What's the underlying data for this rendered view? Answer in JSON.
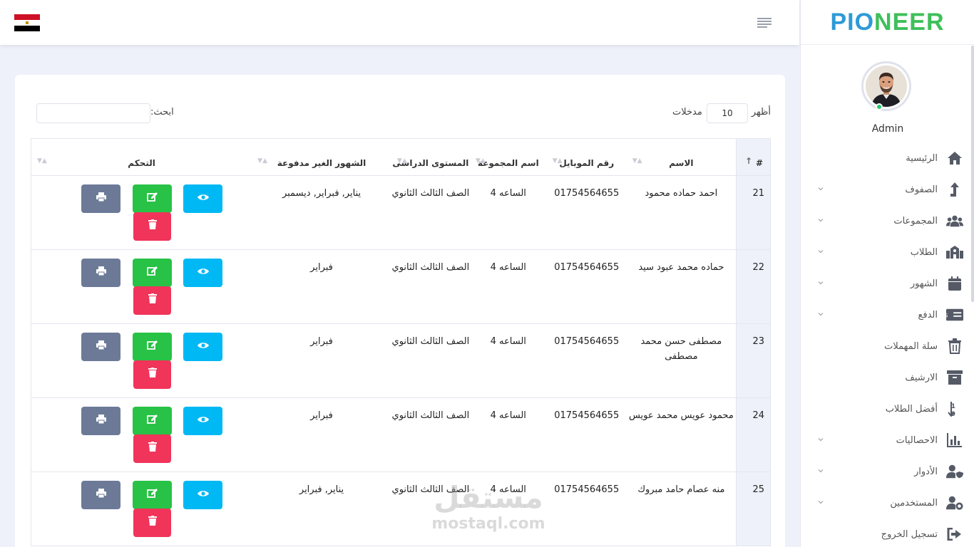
{
  "header": {
    "flag": "egypt-flag"
  },
  "sidebar": {
    "logo_part1": "PIO",
    "logo_part2": "NEER",
    "user": "Admin",
    "items": [
      {
        "label": "الرئيسية",
        "icon": "home-icon",
        "submenu": false
      },
      {
        "label": "الصفوف",
        "icon": "level-up-icon",
        "submenu": true
      },
      {
        "label": "المجموعات",
        "icon": "users-icon",
        "submenu": true
      },
      {
        "label": "الطلاب",
        "icon": "school-icon",
        "submenu": true
      },
      {
        "label": "الشهور",
        "icon": "calendar-icon",
        "submenu": true
      },
      {
        "label": "الدفع",
        "icon": "money-check-icon",
        "submenu": true
      },
      {
        "label": "سلة المهملات",
        "icon": "trash-icon",
        "submenu": false
      },
      {
        "label": "الارشيف",
        "icon": "archive-icon",
        "submenu": false
      },
      {
        "label": "أفضل الطلاب",
        "icon": "sort-numeric-icon",
        "submenu": false
      },
      {
        "label": "الاحصاليات",
        "icon": "chart-bar-icon",
        "submenu": true
      },
      {
        "label": "الأدوار",
        "icon": "user-shield-icon",
        "submenu": true
      },
      {
        "label": "المستخدمين",
        "icon": "user-cog-icon",
        "submenu": true
      },
      {
        "label": "تسجيل الخروج",
        "icon": "sign-out-icon",
        "submenu": false
      }
    ]
  },
  "controls": {
    "show_label": "أظهر",
    "show_value": "10",
    "entries_label": "مدخلات",
    "search_label": "ابحث:",
    "search_value": ""
  },
  "table": {
    "headers": {
      "num": "#",
      "name": "الاسم",
      "mobile": "رقم الموبايل",
      "group": "اسم المجموعة",
      "level": "المستوى الدراسى",
      "months": "الشهور الغير مدفوعة",
      "control": "التحكم"
    },
    "rows": [
      {
        "num": "21",
        "name": "احمد حماده محمود",
        "mobile": "01754564655",
        "group": "الساعه 4",
        "level": "الصف الثالث الثانوي",
        "months": "يناير, فبراير, ديسمبر"
      },
      {
        "num": "22",
        "name": "حماده محمد عبود سيد",
        "mobile": "01754564655",
        "group": "الساعه 4",
        "level": "الصف الثالث الثانوي",
        "months": "فبراير"
      },
      {
        "num": "23",
        "name": "مصطفى حسن محمد مصطفى",
        "mobile": "01754564655",
        "group": "الساعه 4",
        "level": "الصف الثالث الثانوي",
        "months": "فبراير"
      },
      {
        "num": "24",
        "name": "محمود عويس محمد عويس",
        "mobile": "01754564655",
        "group": "الساعه 4",
        "level": "الصف الثالث الثانوي",
        "months": "فبراير"
      },
      {
        "num": "25",
        "name": "منه عصام حامد مبروك",
        "mobile": "01754564655",
        "group": "الساعه 4",
        "level": "الصف الثالث الثانوي",
        "months": "يناير, فبراير"
      }
    ]
  },
  "watermark": {
    "arabic": "مستقل",
    "latin": "mostaql.com"
  },
  "colors": {
    "view": "#00b8f4",
    "edit": "#28c246",
    "print": "#6c7a98",
    "delete": "#f0345a"
  }
}
